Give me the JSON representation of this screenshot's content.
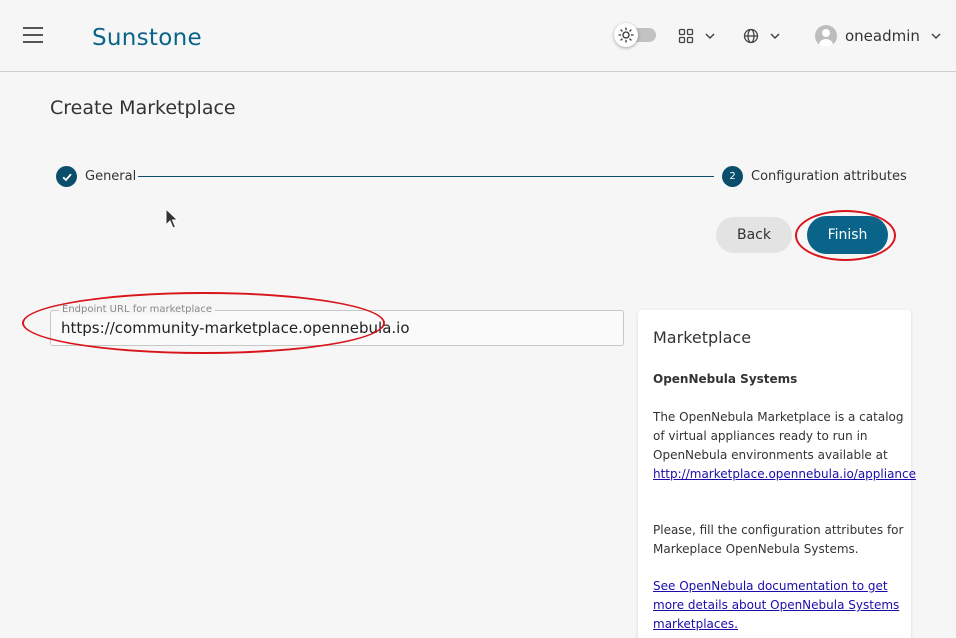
{
  "header": {
    "brand": "Sunstone",
    "user_name": "oneadmin"
  },
  "page": {
    "title": "Create Marketplace"
  },
  "stepper": {
    "steps": [
      {
        "label": "General",
        "state": "completed"
      },
      {
        "number": "2",
        "label": "Configuration attributes",
        "state": "active"
      }
    ]
  },
  "actions": {
    "back_label": "Back",
    "finish_label": "Finish"
  },
  "form": {
    "endpoint_label": "Endpoint URL for marketplace",
    "endpoint_value": "https://community-marketplace.opennebula.io"
  },
  "info_card": {
    "title": "Marketplace",
    "subtitle": "OpenNebula Systems",
    "desc_text": "The OpenNebula Marketplace is a catalog of virtual appliances ready to run in OpenNebula environments available at",
    "desc_link": "http://marketplace.opennebula.io/appliance",
    "fill_text": "Please, fill the configuration attributes for Markeplace OpenNebula Systems.",
    "doc_link": "See OpenNebula documentation to get more details about OpenNebula Systems marketplaces."
  },
  "colors": {
    "primary": "#0a6489",
    "stepper": "#0a4e6b",
    "annotation": "#d8151b",
    "link": "#1a0dab"
  },
  "icons": [
    "menu-icon",
    "sun-icon",
    "apps-grid-icon",
    "globe-icon",
    "chevron-down-icon",
    "avatar-icon",
    "check-icon",
    "mouse-cursor-icon"
  ]
}
